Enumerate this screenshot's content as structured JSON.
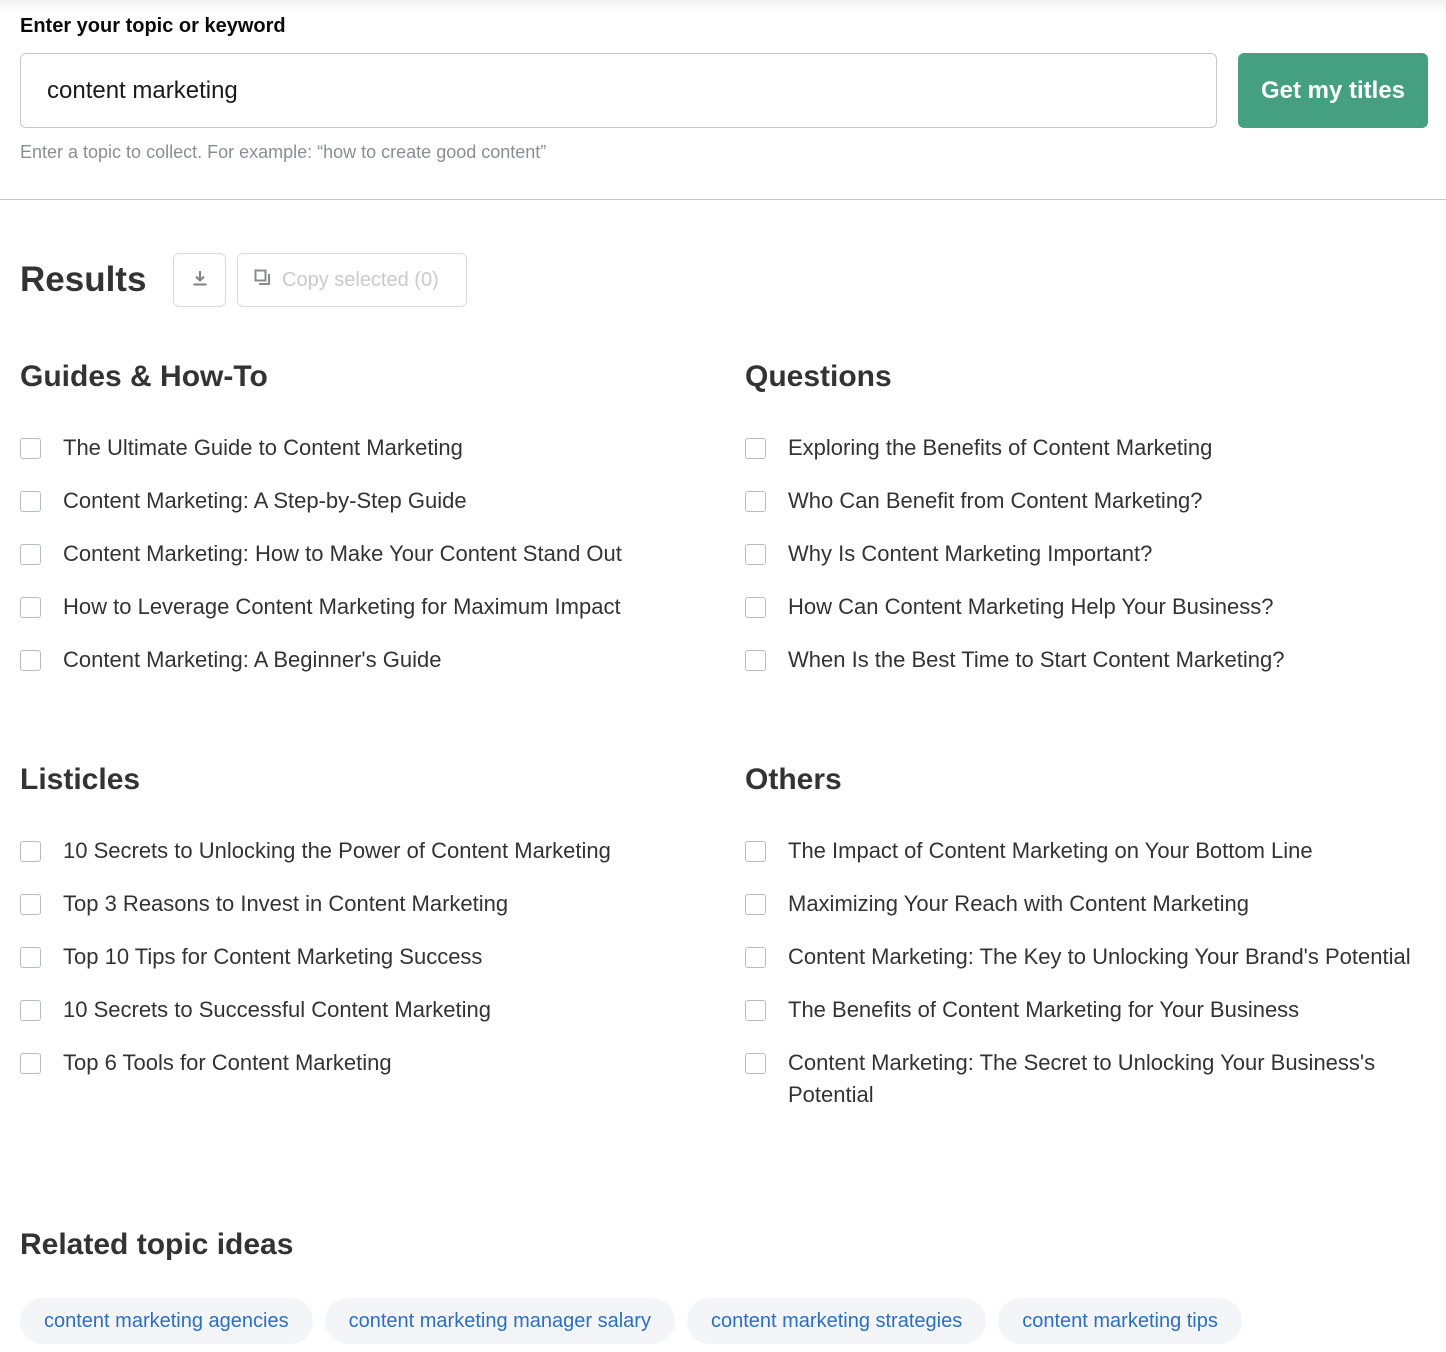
{
  "search": {
    "label": "Enter your topic or keyword",
    "value": "content marketing",
    "hint": "Enter a topic to collect. For example: “how to create good content”",
    "button_label": "Get my titles",
    "button_color": "#45a081"
  },
  "results": {
    "title": "Results",
    "download_icon": "download-icon",
    "copy_icon": "copy-icon",
    "copy_label": "Copy selected (0)",
    "groups": [
      {
        "title": "Guides & How-To",
        "items": [
          "The Ultimate Guide to Content Marketing",
          "Content Marketing: A Step-by-Step Guide",
          "Content Marketing: How to Make Your Content Stand Out",
          "How to Leverage Content Marketing for Maximum Impact",
          "Content Marketing: A Beginner's Guide"
        ]
      },
      {
        "title": "Questions",
        "items": [
          "Exploring the Benefits of Content Marketing",
          "Who Can Benefit from Content Marketing?",
          "Why Is Content Marketing Important?",
          "How Can Content Marketing Help Your Business?",
          "When Is the Best Time to Start Content Marketing?"
        ]
      },
      {
        "title": "Listicles",
        "items": [
          "10 Secrets to Unlocking the Power of Content Marketing",
          "Top 3 Reasons to Invest in Content Marketing",
          "Top 10 Tips for Content Marketing Success",
          "10 Secrets to Successful Content Marketing",
          "Top 6 Tools for Content Marketing"
        ]
      },
      {
        "title": "Others",
        "items": [
          "The Impact of Content Marketing on Your Bottom Line",
          "Maximizing Your Reach with Content Marketing",
          "Content Marketing: The Key to Unlocking Your Brand's Potential",
          "The Benefits of Content Marketing for Your Business",
          "Content Marketing: The Secret to Unlocking Your Business's Potential"
        ]
      }
    ]
  },
  "related": {
    "title": "Related topic ideas",
    "chips": [
      "content marketing agencies",
      "content marketing manager salary",
      "content marketing strategies",
      "content marketing tips"
    ],
    "chip_color": "#2b6fbf"
  }
}
